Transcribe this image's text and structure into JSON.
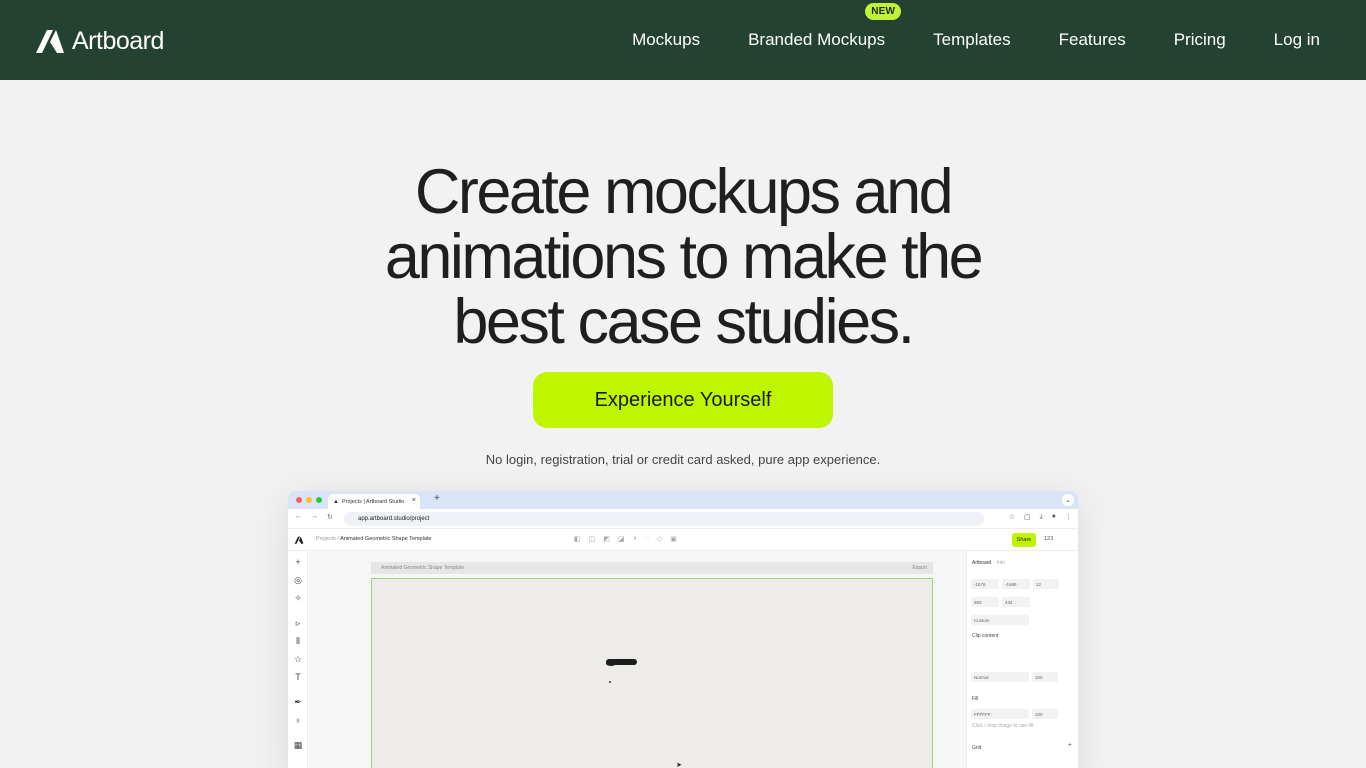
{
  "nav": {
    "brand": "Artboard",
    "links": [
      "Mockups",
      "Branded Mockups",
      "Templates",
      "Features",
      "Pricing",
      "Log in"
    ],
    "badge": "NEW"
  },
  "hero": {
    "title_lines": [
      "Create mockups and",
      "animations to make the",
      "best case studies."
    ],
    "cta": "Experience Yourself",
    "note": "No login, registration, trial or credit card asked, pure app experience."
  },
  "browser": {
    "tab_title": "Projects | Artboard Studio",
    "url": "app.artboard.studio/project",
    "breadcrumb_parent": "Projects",
    "breadcrumb_current": "Animated Geometric Shape Template",
    "frame_label": "Animated Geometric Shape Template",
    "export_label": "Export",
    "share_label": "Share",
    "zoom": "123",
    "panel": {
      "tab_active": "Artboard",
      "tab_inactive": "Info",
      "x": "-1676",
      "y": "-1688",
      "r": "12",
      "w": "982",
      "h": "434",
      "preset": "Custom",
      "clip": "Clip content",
      "blend": "Normal",
      "opacity": "100",
      "fill_label": "Fill",
      "fill_hex": "FFFFFF",
      "fill_opacity": "100",
      "fill_note": "Click / drop image to use fill",
      "grid_label": "Grid"
    }
  },
  "colors": {
    "nav_bg": "#244232",
    "accent": "#c0f500",
    "badge": "#c0f23a",
    "page_bg": "#f2f2f2"
  }
}
